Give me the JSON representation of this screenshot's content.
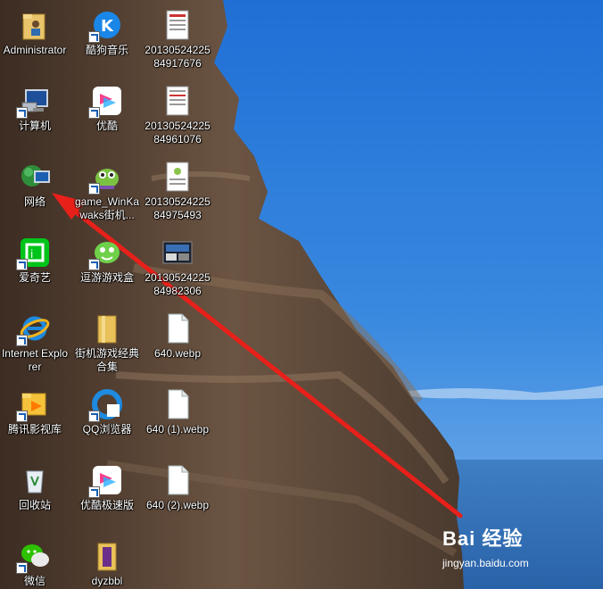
{
  "desktop": {
    "icons": [
      {
        "label": "Administrator",
        "icon": "user-folder-icon"
      },
      {
        "label": "计算机",
        "icon": "computer-icon"
      },
      {
        "label": "网络",
        "icon": "network-icon"
      },
      {
        "label": "爱奇艺",
        "icon": "iqiyi-icon"
      },
      {
        "label": "Internet Explorer",
        "icon": "ie-icon"
      },
      {
        "label": "腾讯影视库",
        "icon": "tencent-video-icon"
      },
      {
        "label": "回收站",
        "icon": "recycle-bin-icon"
      },
      {
        "label": "微信",
        "icon": "wechat-icon"
      },
      {
        "label": "酷狗音乐",
        "icon": "kugou-icon"
      },
      {
        "label": "优酷",
        "icon": "youku-icon"
      },
      {
        "label": "game_WinKawaks街机...",
        "icon": "kawaks-icon"
      },
      {
        "label": "逗游游戏盒",
        "icon": "douyou-icon"
      },
      {
        "label": "街机游戏经典合集",
        "icon": "folder-icon"
      },
      {
        "label": "QQ浏览器",
        "icon": "qq-browser-icon"
      },
      {
        "label": "优酷极速版",
        "icon": "youku-lite-icon"
      },
      {
        "label": "dyzbbl",
        "icon": "winrar-icon"
      },
      {
        "label": "2013052422584917676",
        "icon": "document-thumbnail-icon"
      },
      {
        "label": "2013052422584961076",
        "icon": "document-thumbnail-icon"
      },
      {
        "label": "2013052422584975493",
        "icon": "document-thumbnail-icon"
      },
      {
        "label": "2013052422584982306",
        "icon": "image-thumbnail-icon"
      },
      {
        "label": "640.webp",
        "icon": "file-icon"
      },
      {
        "label": "640 (1).webp",
        "icon": "file-icon"
      },
      {
        "label": "640 (2).webp",
        "icon": "file-icon"
      }
    ]
  },
  "watermark": {
    "logo": "Bai 经验",
    "site": "jingyan.baidu.com"
  },
  "colors": {
    "sky": "#2a7ad8",
    "sea": "#2f6fb8",
    "cliff": "#5a4535",
    "arrow": "#e8201a"
  }
}
